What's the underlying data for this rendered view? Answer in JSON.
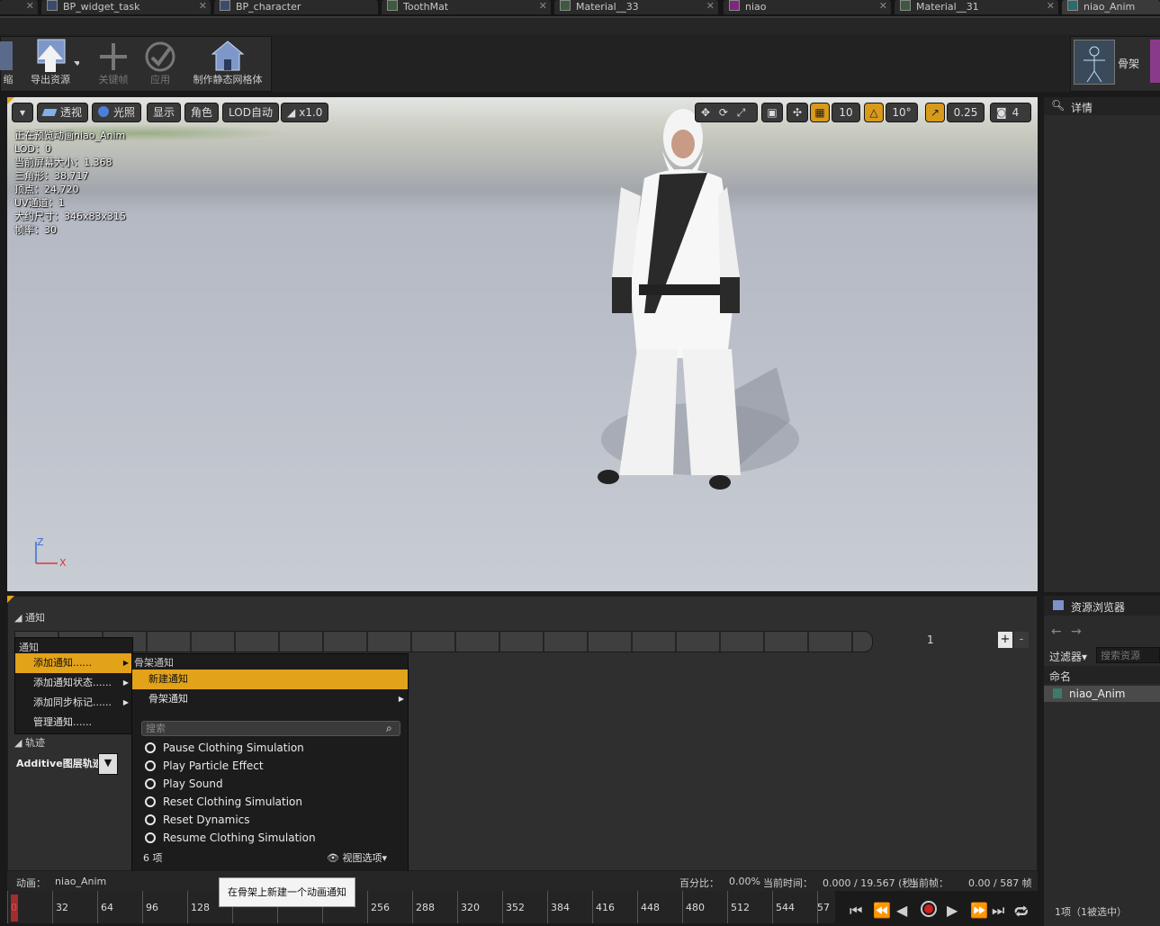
{
  "tabs": [
    {
      "label": "BP_widget_task"
    },
    {
      "label": "BP_character"
    },
    {
      "label": "ToothMat"
    },
    {
      "label": "Material__33"
    },
    {
      "label": "niao"
    },
    {
      "label": "Material__31"
    },
    {
      "label": "niao_Anim"
    }
  ],
  "toolbar": {
    "shrink_label": "缩",
    "export_label": "导出资源",
    "keyframe_label": "关键帧",
    "apply_label": "应用",
    "make_static_mesh_label": "制作静态网格体",
    "skeleton_label": "骨架"
  },
  "viewport": {
    "perspective": "透视",
    "lit": "光照",
    "show": "显示",
    "character": "角色",
    "lod": "LOD自动",
    "speed": "x1.0",
    "grid_snap": "10",
    "rot_snap": "10°",
    "scale_snap": "0.25",
    "cam_speed": "4",
    "stats": [
      "正在预览动画niao_Anim",
      "LOD：0",
      "当前屏幕大小：1.368",
      "三角形：38,717",
      "顶点：24,720",
      "UV通道：1",
      "大约尺寸：346x83x315",
      "帧率：30"
    ],
    "axis_z": "Z",
    "axis_x": "X"
  },
  "details": {
    "title": "详情"
  },
  "asset_browser": {
    "title": "资源浏览器",
    "filter": "过滤器",
    "search_placeholder": "搜索资源",
    "column_name": "命名",
    "items": [
      "niao_Anim"
    ],
    "count": "1项（1被选中）"
  },
  "anim_panel": {
    "notify_section": "通知",
    "track_number": "1",
    "plus": "+",
    "minus": "-",
    "tracks_section": "轨迹",
    "additive_label": "Additive图层轨迹"
  },
  "context_menu": {
    "header": "通知",
    "items": [
      "添加通知......",
      "添加通知状态......",
      "添加同步标记......",
      "管理通知......"
    ]
  },
  "submenu": {
    "header": "骨架通知",
    "new_notify": "新建通知",
    "skeleton_notify": "骨架通知",
    "search_placeholder": "搜索",
    "items": [
      "Pause Clothing Simulation",
      "Play Particle Effect",
      "Play Sound",
      "Reset Clothing Simulation",
      "Reset Dynamics",
      "Resume Clothing Simulation"
    ],
    "count": "6 项",
    "view_options": "视图选项"
  },
  "tooltip": "在骨架上新建一个动画通知",
  "status": {
    "anim_label": "动画：",
    "anim_name": "niao_Anim",
    "percent_label": "百分比：",
    "percent": "0.00%",
    "time_label": "当前时间：",
    "time": "0.000 / 19.567 (秒)",
    "frame_label": "当前帧：",
    "frame": "0.00 / 587 帧"
  },
  "timeline": {
    "ticks": [
      "0",
      "32",
      "64",
      "96",
      "128",
      "256",
      "288",
      "320",
      "352",
      "384",
      "416",
      "448",
      "480",
      "512",
      "544",
      "57"
    ]
  },
  "colors": {
    "accent": "#e2a21a",
    "panel": "#2f2f2f",
    "menu": "#1c1c1c"
  }
}
